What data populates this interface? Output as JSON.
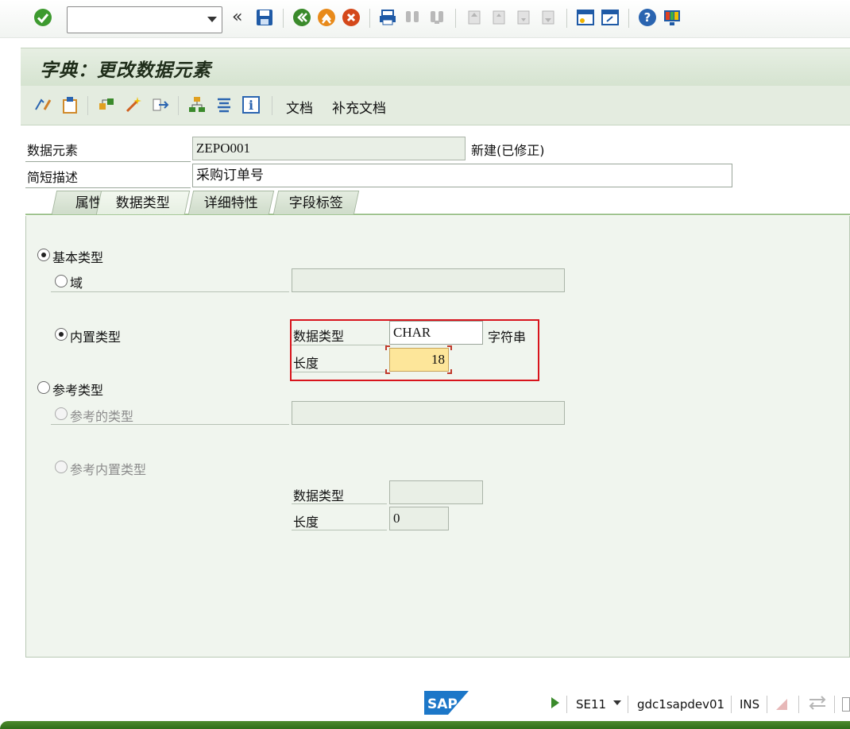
{
  "screen": {
    "title": "字典：更改数据元素",
    "command_field": ""
  },
  "app_toolbar": {
    "doc_label": "文档",
    "supp_doc_label": "补充文档"
  },
  "header": {
    "data_element_label": "数据元素",
    "data_element_value": "ZEPO001",
    "status_text": "新建(已修正)",
    "short_desc_label": "简短描述",
    "short_desc_value": "采购订单号"
  },
  "tabs": [
    {
      "label": "属性"
    },
    {
      "label": "数据类型",
      "active": true
    },
    {
      "label": "详细特性"
    },
    {
      "label": "字段标签"
    }
  ],
  "datatype_tab": {
    "elementary_type": "基本类型",
    "domain": "域",
    "domain_value": "",
    "builtin_type": "内置类型",
    "builtin": {
      "datatype_label": "数据类型",
      "datatype_value": "CHAR",
      "datatype_desc": "字符串",
      "length_label": "长度",
      "length_value": "18"
    },
    "reference_type": "参考类型",
    "ref_type_name": "参考的类型",
    "ref_type_value": "",
    "ref_builtin_type": "参考内置类型",
    "ref_builtin": {
      "datatype_label": "数据类型",
      "datatype_value": "",
      "length_label": "长度",
      "length_value": "0"
    },
    "selected": "builtin_type"
  },
  "status_bar": {
    "logo": "SAP",
    "transaction": "SE11",
    "server": "gdc1sapdev01",
    "mode": "INS"
  }
}
